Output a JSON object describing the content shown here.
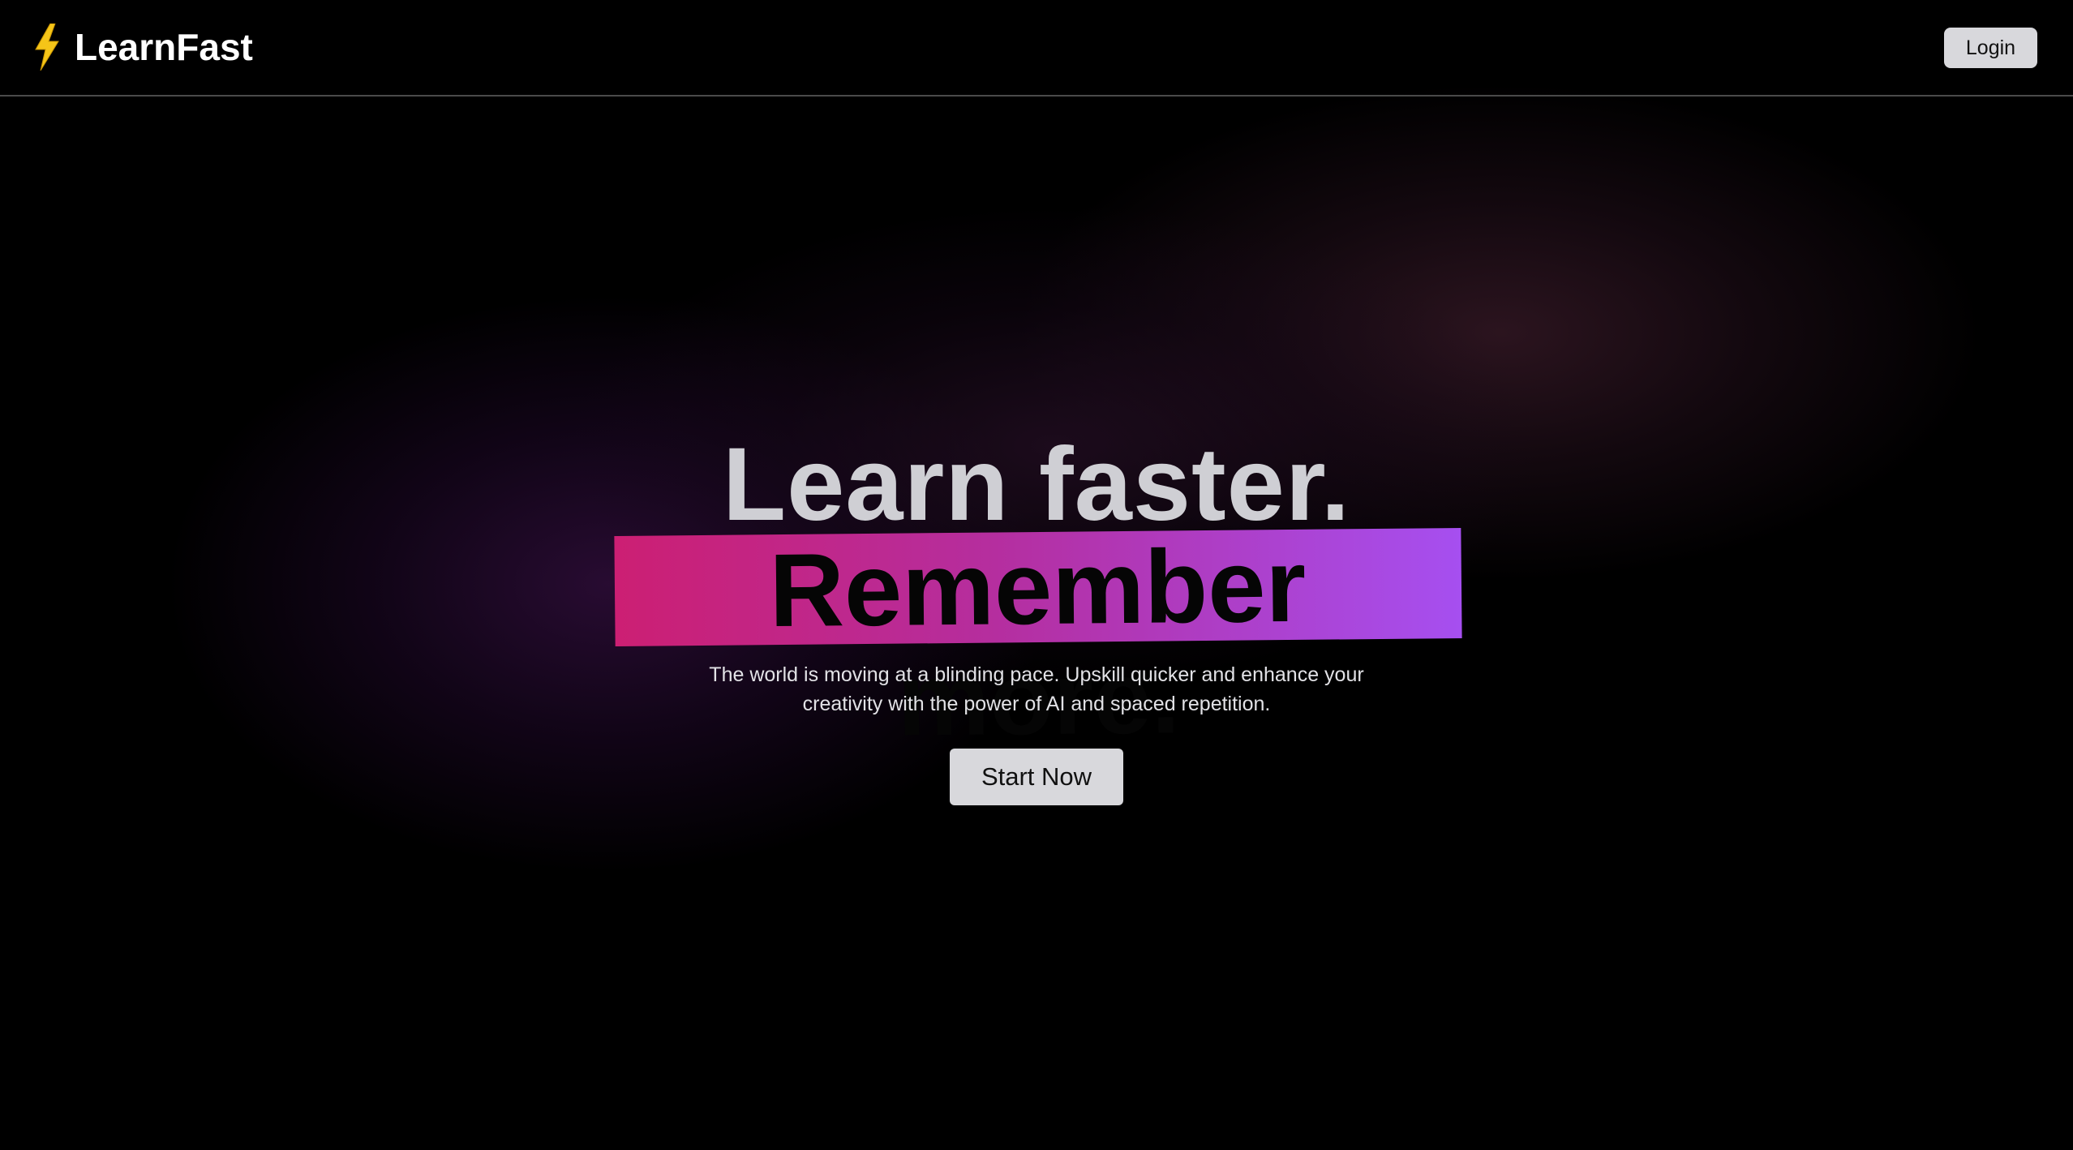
{
  "header": {
    "brand_name": "LearnFast",
    "brand_icon": "lightning-bolt-icon",
    "login_label": "Login"
  },
  "hero": {
    "headline_line1": "Learn faster.",
    "headline_line2": "Remember more.",
    "subtitle": "The world is moving at a blinding pace. Upskill quicker and enhance your creativity with the power of AI and spaced repetition.",
    "cta_label": "Start Now"
  },
  "colors": {
    "background": "#000000",
    "highlight_start": "#cc1f73",
    "highlight_end": "#a64ff0",
    "bolt": "#f5c518",
    "button_bg": "#d8d8dc"
  }
}
